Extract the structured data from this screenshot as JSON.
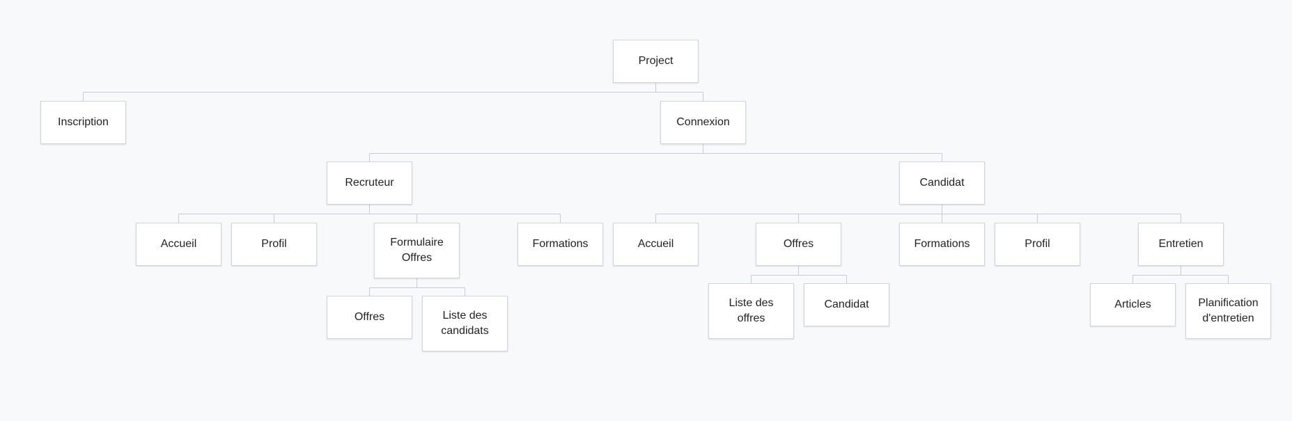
{
  "diagram": {
    "colors": {
      "background": "#f8f9fb",
      "node_fill": "#ffffff",
      "node_border": "#d1d4d9",
      "connector": "#c8ccd2",
      "text": "#222222"
    },
    "nodes": {
      "project": "Project",
      "inscription": "Inscription",
      "connexion": "Connexion",
      "recruteur": "Recruteur",
      "candidat": "Candidat",
      "r_accueil": "Accueil",
      "r_profil": "Profil",
      "r_formulaire_offres": "Formulaire Offres",
      "r_formations": "Formations",
      "r_offres": "Offres",
      "r_liste_candidats": "Liste des candidats",
      "c_accueil": "Accueil",
      "c_offres": "Offres",
      "c_formations": "Formations",
      "c_profil": "Profil",
      "c_entretien": "Entretien",
      "c_liste_offres": "Liste des offres",
      "c_candidat": "Candidat",
      "c_articles": "Articles",
      "c_planification": "Planification d'entretien"
    },
    "edges": [
      [
        "project",
        "inscription"
      ],
      [
        "project",
        "connexion"
      ],
      [
        "connexion",
        "recruteur"
      ],
      [
        "connexion",
        "candidat"
      ],
      [
        "recruteur",
        "r_accueil"
      ],
      [
        "recruteur",
        "r_profil"
      ],
      [
        "recruteur",
        "r_formulaire_offres"
      ],
      [
        "recruteur",
        "r_formations"
      ],
      [
        "r_formulaire_offres",
        "r_offres"
      ],
      [
        "r_formulaire_offres",
        "r_liste_candidats"
      ],
      [
        "candidat",
        "c_accueil"
      ],
      [
        "candidat",
        "c_offres"
      ],
      [
        "candidat",
        "c_formations"
      ],
      [
        "candidat",
        "c_profil"
      ],
      [
        "candidat",
        "c_entretien"
      ],
      [
        "c_offres",
        "c_liste_offres"
      ],
      [
        "c_offres",
        "c_candidat"
      ],
      [
        "c_entretien",
        "c_articles"
      ],
      [
        "c_entretien",
        "c_planification"
      ]
    ]
  }
}
